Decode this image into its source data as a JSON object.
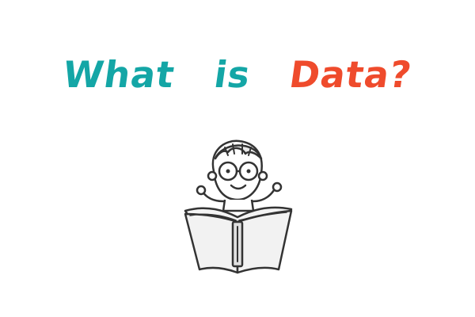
{
  "title": {
    "part_what": "What",
    "part_is": "is",
    "part_data": "Data?",
    "colors": {
      "what": "#14a6a6",
      "is": "#14a6a6",
      "data": "#ef4b2c"
    }
  },
  "illustration": {
    "icon": "child-reading-book-icon"
  }
}
